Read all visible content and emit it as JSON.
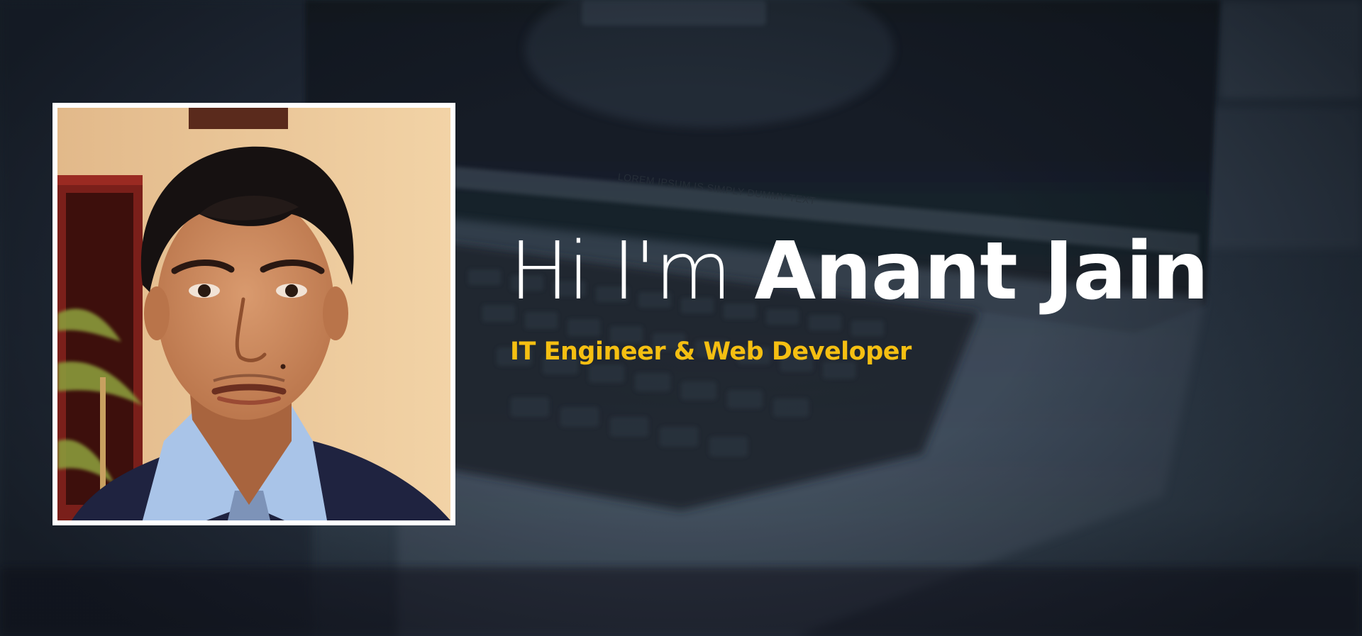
{
  "hero": {
    "greeting": "Hi I'm",
    "name": "Anant Jain",
    "subtitle": "IT Engineer & Web Developer",
    "background_screen_text": "LOREM IPSUM IS SIMPLY DUMMY TEXT"
  },
  "profile_photo": {
    "icon": "profile-photo"
  },
  "colors": {
    "headline": "#ffffff",
    "subtitle": "#f5bf12",
    "photo_border": "#ffffff",
    "background": "#2c3846"
  }
}
